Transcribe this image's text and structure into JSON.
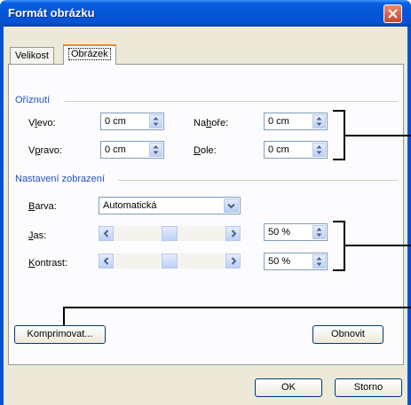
{
  "window": {
    "title": "Formát obrázku"
  },
  "tabs": [
    {
      "label": "Velikost"
    },
    {
      "label": "Obrázek"
    }
  ],
  "crop": {
    "group_label": "Oříznutí",
    "left": {
      "label": "Vlevo:",
      "value": "0 cm"
    },
    "right": {
      "label": "Vpravo:",
      "value": "0 cm"
    },
    "top": {
      "label": "Nahoře:",
      "value": "0 cm"
    },
    "bottom": {
      "label": "Dole:",
      "value": "0 cm"
    }
  },
  "display": {
    "group_label": "Nastavení zobrazení",
    "color": {
      "label": "Barva:",
      "value": "Automatická"
    },
    "brightness": {
      "label": "Jas:",
      "value": "50 %",
      "level": 0.5
    },
    "contrast": {
      "label": "Kontrast:",
      "value": "50 %",
      "level": 0.5
    }
  },
  "buttons": {
    "compress": "Komprimovat...",
    "reset": "Obnovit",
    "ok": "OK",
    "cancel": "Storno"
  }
}
